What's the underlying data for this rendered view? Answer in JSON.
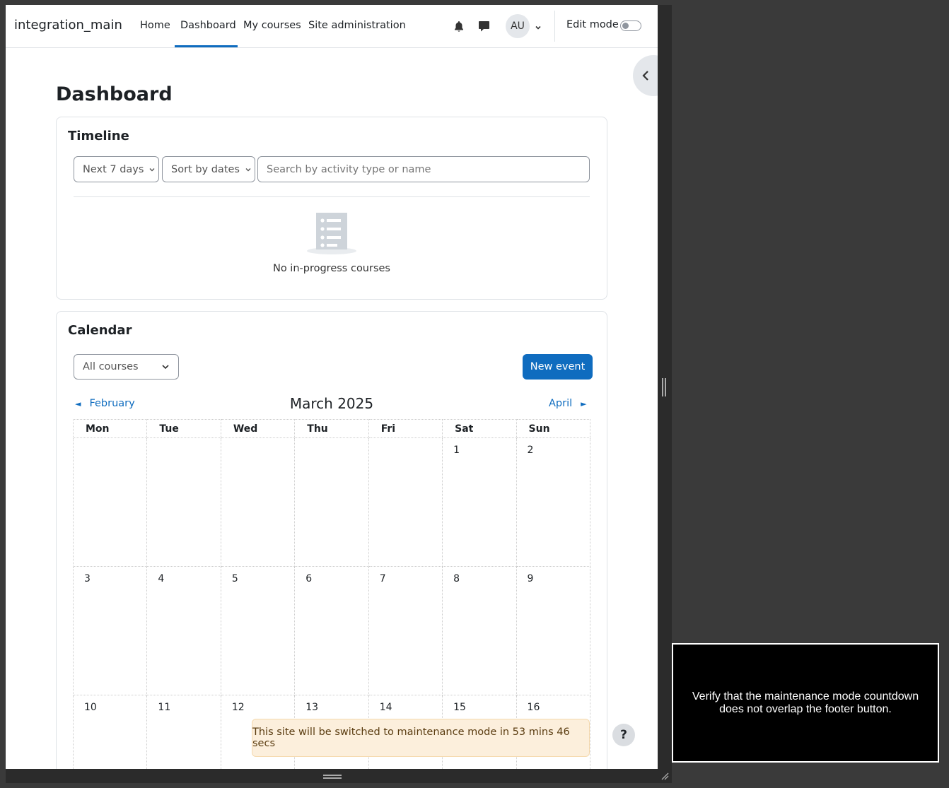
{
  "navbar": {
    "brand": "integration_main",
    "links": [
      "Home",
      "Dashboard",
      "My courses",
      "Site administration"
    ],
    "active_link": "Dashboard",
    "avatar_initials": "AU",
    "edit_mode_label": "Edit mode",
    "edit_mode_on": false
  },
  "page": {
    "title": "Dashboard"
  },
  "timeline": {
    "title": "Timeline",
    "filter_label": "Next 7 days",
    "sort_label": "Sort by dates",
    "search_placeholder": "Search by activity type or name",
    "empty_text": "No in-progress courses"
  },
  "calendar": {
    "title": "Calendar",
    "course_filter": "All courses",
    "new_event_label": "New event",
    "month_title": "March 2025",
    "prev_label": "February",
    "next_label": "April",
    "weekdays": [
      "Mon",
      "Tue",
      "Wed",
      "Thu",
      "Fri",
      "Sat",
      "Sun"
    ],
    "weeks": [
      [
        "",
        "",
        "",
        "",
        "",
        "1",
        "2"
      ],
      [
        "3",
        "4",
        "5",
        "6",
        "7",
        "8",
        "9"
      ],
      [
        "10",
        "11",
        "12",
        "13",
        "14",
        "15",
        "16"
      ]
    ]
  },
  "maintenance_notice": "This site will be switched to maintenance mode in 53 mins 46 secs",
  "help_label": "?",
  "caption": "Verify that the maintenance mode countdown does not overlap the footer button.",
  "colors": {
    "accent": "#0f6cbf",
    "notice_bg": "#fcefdc",
    "backdrop": "#3a3a3a"
  },
  "icons": {
    "notifications": "bell-icon",
    "messages": "chat-bubble-icon",
    "user_menu": "chevron-down-icon",
    "drawer": "chevron-left-icon",
    "empty_state": "list-document-icon"
  }
}
